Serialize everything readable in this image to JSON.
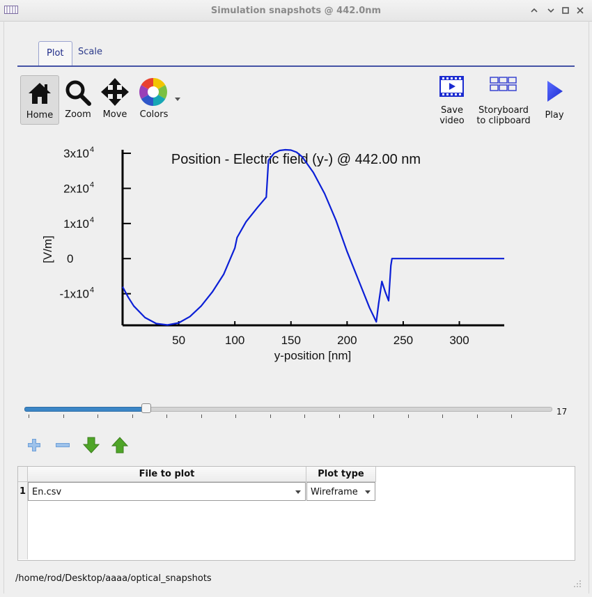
{
  "window": {
    "title": "Simulation snapshots @ 442.0nm"
  },
  "tabs": [
    {
      "label": "Plot"
    },
    {
      "label": "Scale"
    }
  ],
  "toolbar": {
    "home": "Home",
    "zoom": "Zoom",
    "move": "Move",
    "colors": "Colors",
    "save_video_1": "Save",
    "save_video_2": "video",
    "storyboard_1": "Storyboard",
    "storyboard_2": "to clipboard",
    "play": "Play"
  },
  "chart_data": {
    "type": "line",
    "title": "Position - Electric field (y-) @ 442.00 nm",
    "xlabel": "y-position [nm]",
    "ylabel": "[V/m]",
    "xlim": [
      0,
      340
    ],
    "ylim": [
      -19000,
      31000
    ],
    "xticks": [
      50,
      100,
      150,
      200,
      250,
      300
    ],
    "yticks": [
      {
        "value": 30000,
        "base": "3x10",
        "exp": "4"
      },
      {
        "value": 20000,
        "base": "2x10",
        "exp": "4"
      },
      {
        "value": 10000,
        "base": "1x10",
        "exp": "4"
      },
      {
        "value": 0,
        "base": "0",
        "exp": ""
      },
      {
        "value": -10000,
        "base": "-1x10",
        "exp": "4"
      }
    ],
    "series": [
      {
        "color": "#0b1fd6",
        "x": [
          0,
          5,
          10,
          20,
          30,
          40,
          50,
          60,
          70,
          80,
          90,
          100,
          102,
          110,
          120,
          128,
          130,
          135,
          140,
          145,
          150,
          155,
          160,
          170,
          180,
          190,
          200,
          210,
          220,
          226,
          228,
          231,
          234,
          237,
          239,
          240,
          241,
          260,
          280,
          300,
          320,
          340
        ],
        "y": [
          -8000,
          -11000,
          -13500,
          -16800,
          -18500,
          -18900,
          -18300,
          -16500,
          -13500,
          -9500,
          -4500,
          3000,
          6000,
          10500,
          14500,
          17500,
          28000,
          30000,
          30800,
          31000,
          30900,
          30300,
          29000,
          24500,
          18500,
          11000,
          2000,
          -6000,
          -14000,
          -18000,
          -13000,
          -6500,
          -9500,
          -12000,
          -2000,
          0,
          0,
          0,
          0,
          0,
          0,
          0
        ]
      }
    ]
  },
  "slider": {
    "value": 17,
    "fraction": 0.23
  },
  "table": {
    "headers": [
      "File to plot",
      "Plot type"
    ],
    "rows": [
      {
        "index": "1",
        "file": "En.csv",
        "plot_type": "Wireframe"
      }
    ]
  },
  "status": {
    "path": "/home/rod/Desktop/aaaa/optical_snapshots"
  },
  "icons": {
    "add": "plus-icon",
    "remove": "minus-icon",
    "down": "arrow-down-icon",
    "up": "arrow-up-icon"
  }
}
